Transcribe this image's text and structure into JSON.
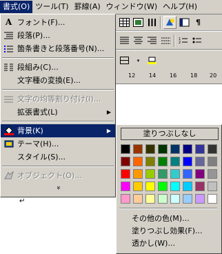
{
  "menubar": {
    "items": [
      "書式(O)",
      "ツール(T)",
      "罫線(A)",
      "ウィンドウ(W)",
      "ヘルプ(H)"
    ]
  },
  "format_menu": {
    "items": [
      {
        "label": "フォント(F)...",
        "icon": "font-a-icon"
      },
      {
        "label": "段落(P)...",
        "icon": "paragraph-icon"
      },
      {
        "label": "箇条書きと段落番号(N)...",
        "icon": "bullets-numbering-icon"
      },
      {
        "label": "段組み(C)...",
        "icon": "columns-icon"
      },
      {
        "label": "文字種の変換(E)...",
        "icon": ""
      },
      {
        "label": "文字の均等割り付け(I)...",
        "icon": "distribute-text-icon",
        "disabled": true
      },
      {
        "label": "拡張書式(L)",
        "icon": "",
        "submenu": true
      },
      {
        "label": "背景(K)",
        "icon": "background-bucket-icon",
        "submenu": true,
        "selected": true
      },
      {
        "label": "テーマ(H)...",
        "icon": "theme-icon"
      },
      {
        "label": "スタイル(S)...",
        "icon": ""
      },
      {
        "label": "オブジェクト(O)...",
        "icon": "object-icon",
        "disabled": true
      }
    ],
    "expand_glyph": "»"
  },
  "background_submenu": {
    "no_fill_label": "塗りつぶしなし",
    "colors": [
      "#000000",
      "#993300",
      "#333300",
      "#003300",
      "#003366",
      "#000080",
      "#333399",
      "#333333",
      "#800000",
      "#ff6600",
      "#808000",
      "#008000",
      "#008080",
      "#0000ff",
      "#666699",
      "#808080",
      "#ff0000",
      "#ff9900",
      "#99cc00",
      "#339966",
      "#33cccc",
      "#3366ff",
      "#800080",
      "#969696",
      "#ff00ff",
      "#ffcc00",
      "#ffff00",
      "#00ff00",
      "#00ffff",
      "#00ccff",
      "#993366",
      "#c0c0c0",
      "#ff99cc",
      "#ffcc99",
      "#ffff99",
      "#ccffcc",
      "#ccffff",
      "#99ccff",
      "#cc99ff",
      "#ffffff"
    ],
    "more_colors_label": "その他の色(M)...",
    "fill_effects_label": "塗りつぶし効果(F)...",
    "watermark_label": "透かし(W)..."
  },
  "ruler": {
    "ticks": [
      "12",
      "14",
      "16",
      "18",
      "20"
    ]
  },
  "document": {
    "paragraph_mark": "↵"
  }
}
